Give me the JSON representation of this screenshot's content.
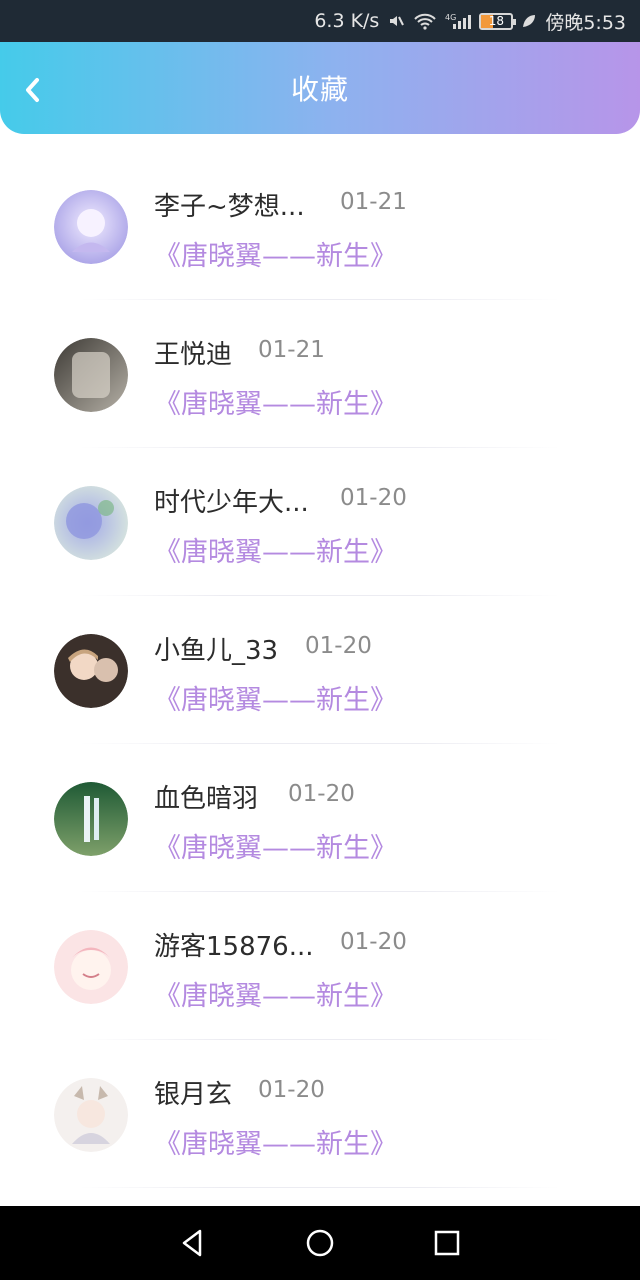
{
  "status": {
    "net_speed": "6.3 K/s",
    "network": "4G",
    "battery": "18",
    "time": "傍晚5:53"
  },
  "header": {
    "title": "收藏"
  },
  "items": [
    {
      "name": "李子~梦想...",
      "date": "01-21",
      "book": "《唐晓翼——新生》"
    },
    {
      "name": "王悦迪",
      "date": "01-21",
      "book": "《唐晓翼——新生》"
    },
    {
      "name": "时代少年大...",
      "date": "01-20",
      "book": "《唐晓翼——新生》"
    },
    {
      "name": "小鱼儿_33",
      "date": "01-20",
      "book": "《唐晓翼——新生》"
    },
    {
      "name": "血色暗羽",
      "date": "01-20",
      "book": "《唐晓翼——新生》"
    },
    {
      "name": "游客15876...",
      "date": "01-20",
      "book": "《唐晓翼——新生》"
    },
    {
      "name": "银月玄",
      "date": "01-20",
      "book": "《唐晓翼——新生》"
    }
  ]
}
